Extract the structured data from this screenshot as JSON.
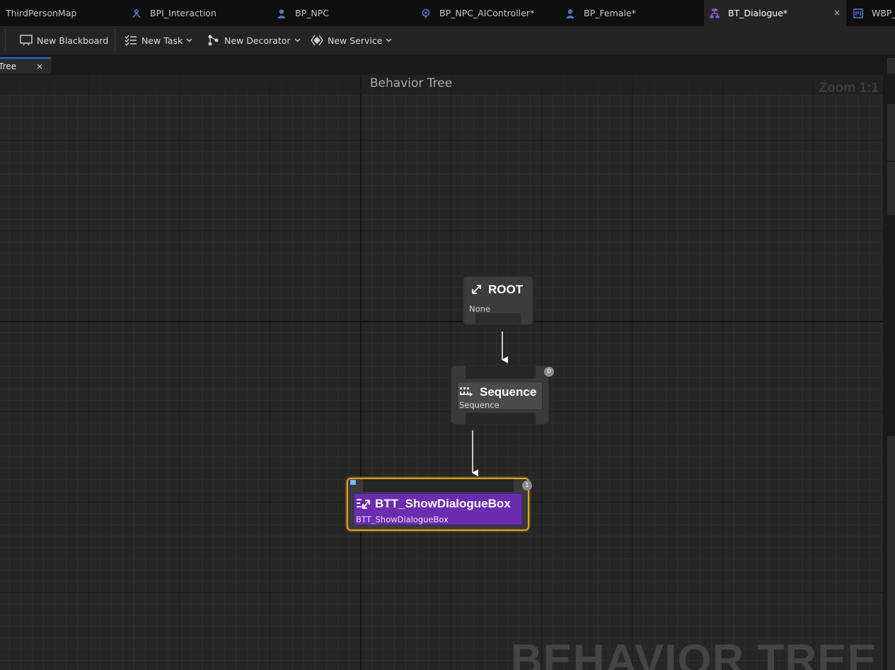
{
  "tabs": [
    {
      "label": "ThirdPersonMap",
      "icon": "none"
    },
    {
      "label": "BPI_Interaction",
      "icon": "blueprint-interface-icon"
    },
    {
      "label": "BP_NPC",
      "icon": "character-blueprint-icon"
    },
    {
      "label": "BP_NPC_AIController*",
      "icon": "ai-controller-icon"
    },
    {
      "label": "BP_Female*",
      "icon": "character-blueprint-icon"
    },
    {
      "label": "BT_Dialogue*",
      "icon": "behavior-tree-icon",
      "active": true
    },
    {
      "label": "WBP_",
      "icon": "widget-blueprint-icon"
    }
  ],
  "tab_close": "×",
  "toolbar": {
    "new_blackboard": "New Blackboard",
    "new_task": "New Task",
    "new_decorator": "New Decorator",
    "new_service": "New Service"
  },
  "graph_tab": {
    "label": "Tree",
    "close": "×"
  },
  "canvas": {
    "title": "Behavior Tree",
    "zoom": "Zoom 1:1",
    "watermark": "BEHAVIOR TREE"
  },
  "nodes": {
    "root": {
      "title": "ROOT",
      "subtitle": "None"
    },
    "sequence": {
      "title": "Sequence",
      "subtitle": "Sequence",
      "index": "0"
    },
    "task": {
      "title": "BTT_ShowDialogueBox",
      "subtitle": "BTT_ShowDialogueBox",
      "index": "1"
    }
  },
  "colors": {
    "active_tab_accent": "#8f5bd6",
    "task_node": "#6b2cb0",
    "selection": "#e0a11b",
    "graph_tab_accent": "#1e6fd9"
  }
}
